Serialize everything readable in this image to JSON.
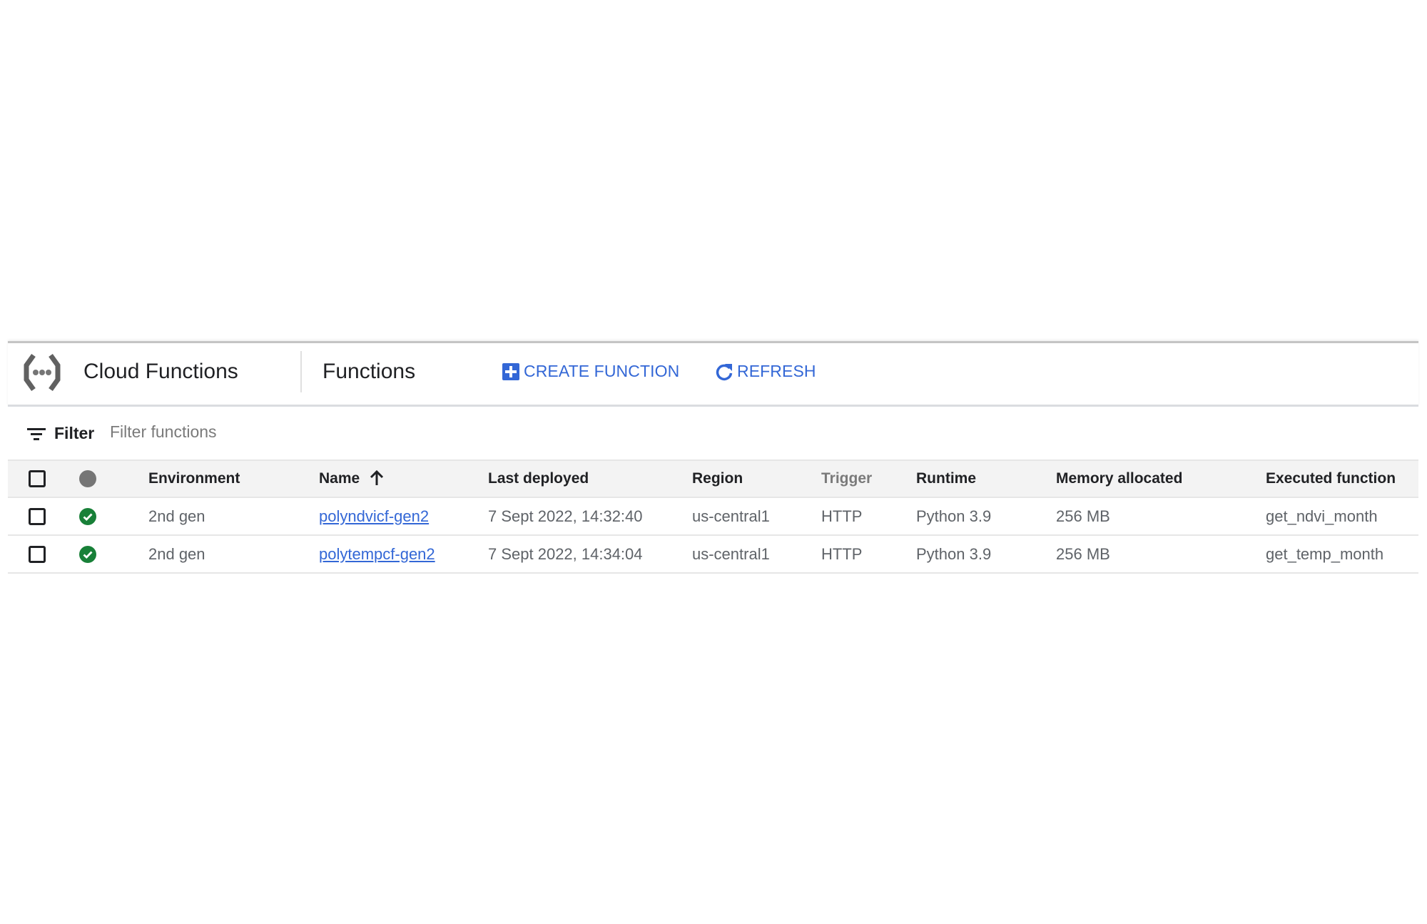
{
  "header": {
    "product_title": "Cloud Functions",
    "product_icon": "cloud-functions-logo-icon",
    "page_title": "Functions",
    "actions": [
      {
        "label": "CREATE FUNCTION",
        "icon": "add-box-icon"
      },
      {
        "label": "REFRESH",
        "icon": "refresh-icon"
      }
    ],
    "accent_color": "#3367d6"
  },
  "filter": {
    "label": "Filter",
    "icon": "filter-list-icon",
    "placeholder": "Filter functions",
    "value": ""
  },
  "table": {
    "columns": [
      {
        "label": "",
        "kind": "select-all-checkbox"
      },
      {
        "label": "",
        "kind": "status"
      },
      {
        "label": "Environment"
      },
      {
        "label": "Name",
        "sort": "ascending"
      },
      {
        "label": "Last deployed"
      },
      {
        "label": "Region"
      },
      {
        "label": "Trigger"
      },
      {
        "label": "Runtime"
      },
      {
        "label": "Memory allocated"
      },
      {
        "label": "Executed function"
      }
    ],
    "rows": [
      {
        "checked": false,
        "status": "ok",
        "environment": "2nd gen",
        "name": "polyndvicf-gen2",
        "last_deployed": "7 Sept 2022, 14:32:40",
        "region": "us-central1",
        "trigger": "HTTP",
        "runtime": "Python 3.9",
        "memory": "256 MB",
        "executed_function": "get_ndvi_month"
      },
      {
        "checked": false,
        "status": "ok",
        "environment": "2nd gen",
        "name": "polytempcf-gen2",
        "last_deployed": "7 Sept 2022, 14:34:04",
        "region": "us-central1",
        "trigger": "HTTP",
        "runtime": "Python 3.9",
        "memory": "256 MB",
        "executed_function": "get_temp_month"
      }
    ],
    "status_colors": {
      "ok": "#188038",
      "header": "#757575"
    }
  }
}
